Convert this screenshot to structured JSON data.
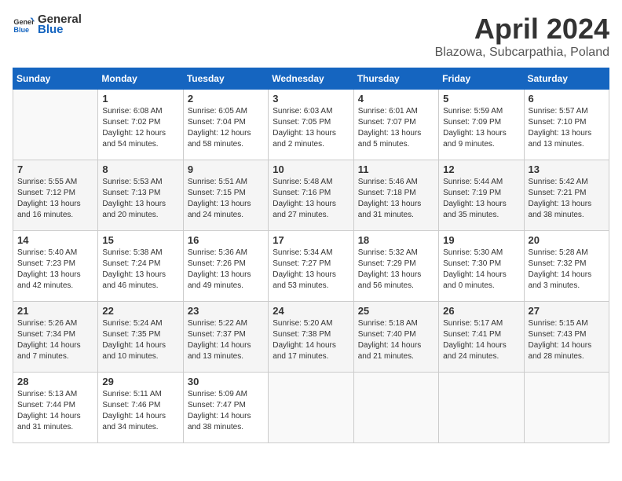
{
  "header": {
    "logo_general": "General",
    "logo_blue": "Blue",
    "month_year": "April 2024",
    "location": "Blazowa, Subcarpathia, Poland"
  },
  "weekdays": [
    "Sunday",
    "Monday",
    "Tuesday",
    "Wednesday",
    "Thursday",
    "Friday",
    "Saturday"
  ],
  "weeks": [
    [
      {
        "day": "",
        "info": ""
      },
      {
        "day": "1",
        "info": "Sunrise: 6:08 AM\nSunset: 7:02 PM\nDaylight: 12 hours\nand 54 minutes."
      },
      {
        "day": "2",
        "info": "Sunrise: 6:05 AM\nSunset: 7:04 PM\nDaylight: 12 hours\nand 58 minutes."
      },
      {
        "day": "3",
        "info": "Sunrise: 6:03 AM\nSunset: 7:05 PM\nDaylight: 13 hours\nand 2 minutes."
      },
      {
        "day": "4",
        "info": "Sunrise: 6:01 AM\nSunset: 7:07 PM\nDaylight: 13 hours\nand 5 minutes."
      },
      {
        "day": "5",
        "info": "Sunrise: 5:59 AM\nSunset: 7:09 PM\nDaylight: 13 hours\nand 9 minutes."
      },
      {
        "day": "6",
        "info": "Sunrise: 5:57 AM\nSunset: 7:10 PM\nDaylight: 13 hours\nand 13 minutes."
      }
    ],
    [
      {
        "day": "7",
        "info": "Sunrise: 5:55 AM\nSunset: 7:12 PM\nDaylight: 13 hours\nand 16 minutes."
      },
      {
        "day": "8",
        "info": "Sunrise: 5:53 AM\nSunset: 7:13 PM\nDaylight: 13 hours\nand 20 minutes."
      },
      {
        "day": "9",
        "info": "Sunrise: 5:51 AM\nSunset: 7:15 PM\nDaylight: 13 hours\nand 24 minutes."
      },
      {
        "day": "10",
        "info": "Sunrise: 5:48 AM\nSunset: 7:16 PM\nDaylight: 13 hours\nand 27 minutes."
      },
      {
        "day": "11",
        "info": "Sunrise: 5:46 AM\nSunset: 7:18 PM\nDaylight: 13 hours\nand 31 minutes."
      },
      {
        "day": "12",
        "info": "Sunrise: 5:44 AM\nSunset: 7:19 PM\nDaylight: 13 hours\nand 35 minutes."
      },
      {
        "day": "13",
        "info": "Sunrise: 5:42 AM\nSunset: 7:21 PM\nDaylight: 13 hours\nand 38 minutes."
      }
    ],
    [
      {
        "day": "14",
        "info": "Sunrise: 5:40 AM\nSunset: 7:23 PM\nDaylight: 13 hours\nand 42 minutes."
      },
      {
        "day": "15",
        "info": "Sunrise: 5:38 AM\nSunset: 7:24 PM\nDaylight: 13 hours\nand 46 minutes."
      },
      {
        "day": "16",
        "info": "Sunrise: 5:36 AM\nSunset: 7:26 PM\nDaylight: 13 hours\nand 49 minutes."
      },
      {
        "day": "17",
        "info": "Sunrise: 5:34 AM\nSunset: 7:27 PM\nDaylight: 13 hours\nand 53 minutes."
      },
      {
        "day": "18",
        "info": "Sunrise: 5:32 AM\nSunset: 7:29 PM\nDaylight: 13 hours\nand 56 minutes."
      },
      {
        "day": "19",
        "info": "Sunrise: 5:30 AM\nSunset: 7:30 PM\nDaylight: 14 hours\nand 0 minutes."
      },
      {
        "day": "20",
        "info": "Sunrise: 5:28 AM\nSunset: 7:32 PM\nDaylight: 14 hours\nand 3 minutes."
      }
    ],
    [
      {
        "day": "21",
        "info": "Sunrise: 5:26 AM\nSunset: 7:34 PM\nDaylight: 14 hours\nand 7 minutes."
      },
      {
        "day": "22",
        "info": "Sunrise: 5:24 AM\nSunset: 7:35 PM\nDaylight: 14 hours\nand 10 minutes."
      },
      {
        "day": "23",
        "info": "Sunrise: 5:22 AM\nSunset: 7:37 PM\nDaylight: 14 hours\nand 13 minutes."
      },
      {
        "day": "24",
        "info": "Sunrise: 5:20 AM\nSunset: 7:38 PM\nDaylight: 14 hours\nand 17 minutes."
      },
      {
        "day": "25",
        "info": "Sunrise: 5:18 AM\nSunset: 7:40 PM\nDaylight: 14 hours\nand 21 minutes."
      },
      {
        "day": "26",
        "info": "Sunrise: 5:17 AM\nSunset: 7:41 PM\nDaylight: 14 hours\nand 24 minutes."
      },
      {
        "day": "27",
        "info": "Sunrise: 5:15 AM\nSunset: 7:43 PM\nDaylight: 14 hours\nand 28 minutes."
      }
    ],
    [
      {
        "day": "28",
        "info": "Sunrise: 5:13 AM\nSunset: 7:44 PM\nDaylight: 14 hours\nand 31 minutes."
      },
      {
        "day": "29",
        "info": "Sunrise: 5:11 AM\nSunset: 7:46 PM\nDaylight: 14 hours\nand 34 minutes."
      },
      {
        "day": "30",
        "info": "Sunrise: 5:09 AM\nSunset: 7:47 PM\nDaylight: 14 hours\nand 38 minutes."
      },
      {
        "day": "",
        "info": ""
      },
      {
        "day": "",
        "info": ""
      },
      {
        "day": "",
        "info": ""
      },
      {
        "day": "",
        "info": ""
      }
    ]
  ]
}
